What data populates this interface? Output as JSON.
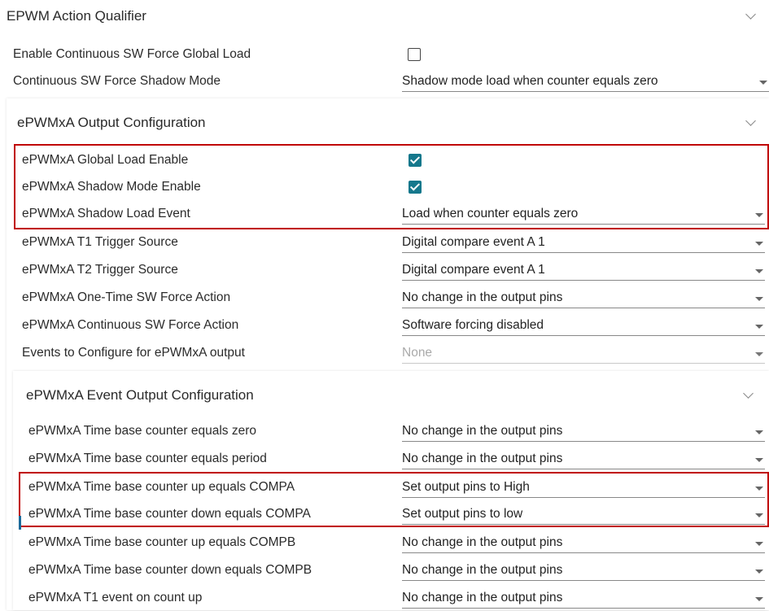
{
  "section": {
    "title": "EPWM Action Qualifier"
  },
  "top_rows": [
    {
      "label": "Enable Continuous SW Force Global Load",
      "checked": false
    },
    {
      "label": "Continuous SW Force Shadow Mode",
      "value": "Shadow mode load when counter equals zero"
    }
  ],
  "output_config": {
    "title": "ePWMxA Output Configuration",
    "rows": [
      {
        "label": "ePWMxA Global Load Enable",
        "checked": true
      },
      {
        "label": "ePWMxA Shadow Mode Enable",
        "checked": true
      },
      {
        "label": "ePWMxA Shadow Load Event",
        "value": "Load when counter equals zero"
      },
      {
        "label": "ePWMxA T1 Trigger Source",
        "value": "Digital compare event A 1"
      },
      {
        "label": "ePWMxA T2 Trigger Source",
        "value": "Digital compare event A 1"
      },
      {
        "label": "ePWMxA One-Time SW Force Action",
        "value": "No change in the output pins"
      },
      {
        "label": "ePWMxA Continuous SW Force Action",
        "value": "Software forcing disabled"
      },
      {
        "label": "Events to Configure for ePWMxA output",
        "value": "None",
        "disabled": true
      }
    ]
  },
  "event_config": {
    "title": "ePWMxA Event Output Configuration",
    "rows": [
      {
        "label": "ePWMxA Time base counter equals zero",
        "value": "No change in the output pins"
      },
      {
        "label": "ePWMxA Time base counter equals period",
        "value": "No change in the output pins"
      },
      {
        "label": "ePWMxA Time base counter up equals COMPA",
        "value": "Set output pins to High"
      },
      {
        "label": "ePWMxA Time base counter down equals COMPA",
        "value": "Set output pins to low"
      },
      {
        "label": "ePWMxA Time base counter up equals COMPB",
        "value": "No change in the output pins"
      },
      {
        "label": "ePWMxA Time base counter down equals COMPB",
        "value": "No change in the output pins"
      },
      {
        "label": "ePWMxA T1 event on count up",
        "value": "No change in the output pins"
      }
    ]
  },
  "colors": {
    "checkbox_accent": "#15788c",
    "highlight": "#c00000"
  }
}
